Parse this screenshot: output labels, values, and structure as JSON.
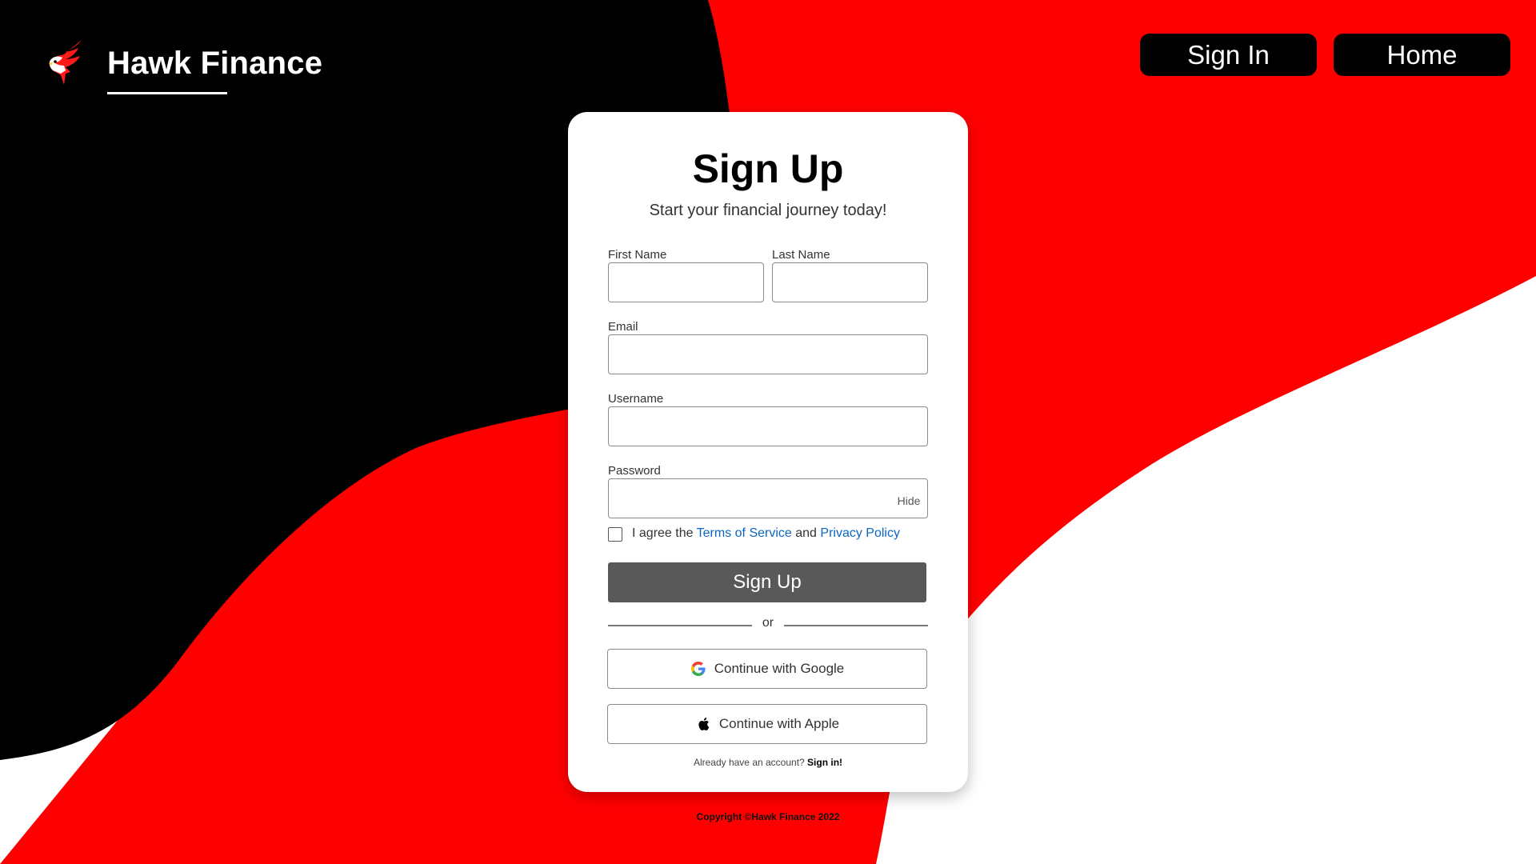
{
  "colors": {
    "black": "#000000",
    "red": "#ff0000",
    "white": "#ffffff",
    "link": "#0a66c2",
    "primary_button": "#595959"
  },
  "header": {
    "logo_icon": "hawk-icon",
    "brand_name": "Hawk Finance",
    "nav": {
      "sign_in": "Sign In",
      "home": "Home"
    }
  },
  "signup": {
    "title": "Sign Up",
    "subtitle": "Start your financial journey today!",
    "fields": {
      "first_name_label": "First Name",
      "first_name_value": "",
      "last_name_label": "Last Name",
      "last_name_value": "",
      "email_label": "Email",
      "email_value": "",
      "username_label": "Username",
      "username_value": "",
      "password_label": "Password",
      "password_value": "",
      "password_toggle": "Hide"
    },
    "agreement": {
      "checked": false,
      "prefix": "I agree the",
      "terms_link": "Terms of Service",
      "conjunction": "and",
      "privacy_link": "Privacy Policy"
    },
    "submit_label": "Sign Up",
    "divider_text": "or",
    "google_label": "Continue with Google",
    "google_icon": "google-icon",
    "apple_label": "Continue with Apple",
    "apple_icon": "apple-icon",
    "already_text": "Already have an account?",
    "signin_link": "Sign in!"
  },
  "footer": {
    "copyright": "Copyright ©Hawk Finance 2022"
  }
}
